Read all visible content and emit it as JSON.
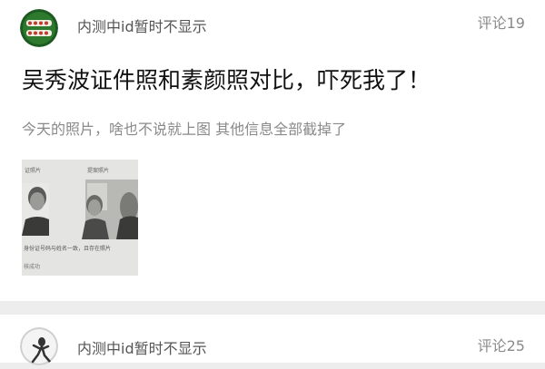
{
  "posts": [
    {
      "user": "内测中id暂时不显示",
      "comments": "评论19",
      "title": "吴秀波证件照和素颜照对比，吓死我了！",
      "body": "今天的照片，啥也不说就上图 其他信息全部截掉了",
      "image": {
        "left_label": "证照片",
        "right_label": "提案照片",
        "caption": "身份证号码与姓名一致，且存在照片",
        "footer": "核成功"
      }
    },
    {
      "user": "内测中id暂时不显示",
      "comments": "评论25"
    }
  ]
}
